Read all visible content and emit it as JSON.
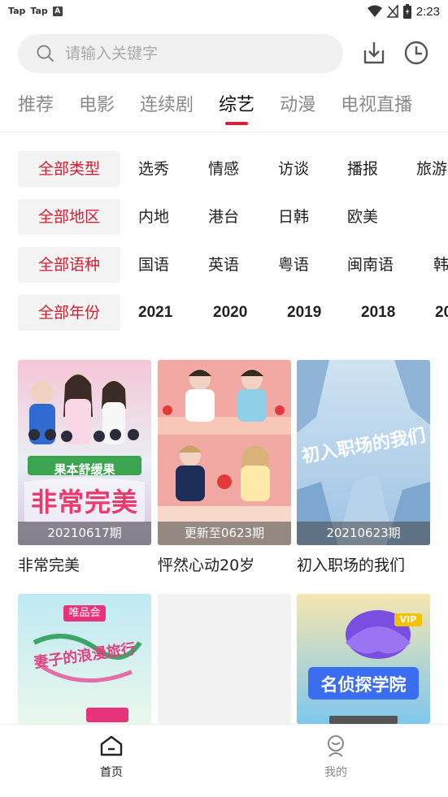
{
  "status_bar": {
    "left_labels": [
      "Tap",
      "Tap",
      "A"
    ],
    "time": "2:23"
  },
  "search": {
    "placeholder": "请输入关键字"
  },
  "tabs": [
    {
      "label": "推荐"
    },
    {
      "label": "电影"
    },
    {
      "label": "连续剧"
    },
    {
      "label": "综艺",
      "active": true
    },
    {
      "label": "动漫"
    },
    {
      "label": "电视直播"
    }
  ],
  "filters": [
    {
      "selected": "全部类型",
      "options": [
        "选秀",
        "情感",
        "访谈",
        "播报",
        "旅游"
      ]
    },
    {
      "selected": "全部地区",
      "options": [
        "内地",
        "港台",
        "日韩",
        "欧美"
      ]
    },
    {
      "selected": "全部语种",
      "options": [
        "国语",
        "英语",
        "粤语",
        "闽南语",
        "韩"
      ]
    },
    {
      "selected": "全部年份",
      "options": [
        "2021",
        "2020",
        "2019",
        "2018",
        "20"
      ]
    }
  ],
  "shows": [
    {
      "title": "非常完美",
      "badge": "20210617期",
      "poster_text": "非常完美",
      "poster_subtext": "果本舒缓果"
    },
    {
      "title": "怦然心动20岁",
      "badge": "更新至0623期",
      "poster_text": "",
      "poster_subtext": ""
    },
    {
      "title": "初入职场的我们",
      "badge": "20210623期",
      "poster_text": "初入职场的我们",
      "poster_subtext": ""
    },
    {
      "title": "",
      "badge": "",
      "poster_text": "妻子的浪漫旅行",
      "poster_subtext": "唯品会"
    },
    {
      "title": "",
      "badge": "",
      "poster_text": "",
      "poster_subtext": ""
    },
    {
      "title": "",
      "badge": "",
      "poster_text": "名侦探学院",
      "poster_subtext": "VIP"
    }
  ],
  "bottom_nav": [
    {
      "label": "首页",
      "active": true
    },
    {
      "label": "我的",
      "active": false
    }
  ],
  "colors": {
    "accent": "#d91e36",
    "chip_bg": "#f3f3f4",
    "inactive_tab": "#8a8a8a"
  }
}
